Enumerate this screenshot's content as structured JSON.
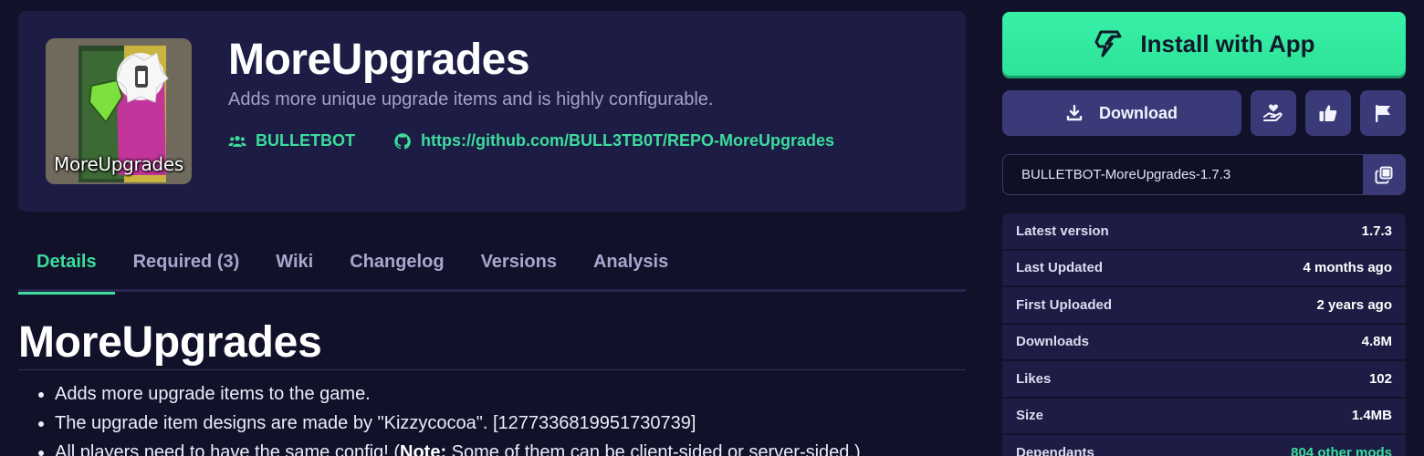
{
  "package": {
    "title": "MoreUpgrades",
    "description": "Adds more unique upgrade items and is highly configurable.",
    "thumbnail_label": "MoreUpgrades",
    "author": "BULLETBOT",
    "repo_url": "https://github.com/BULL3TB0T/REPO-MoreUpgrades"
  },
  "tabs": [
    {
      "label": "Details",
      "active": true
    },
    {
      "label": "Required (3)",
      "active": false
    },
    {
      "label": "Wiki",
      "active": false
    },
    {
      "label": "Changelog",
      "active": false
    },
    {
      "label": "Versions",
      "active": false
    },
    {
      "label": "Analysis",
      "active": false
    }
  ],
  "readme": {
    "title": "MoreUpgrades",
    "items": [
      {
        "text": "Adds more upgrade items to the game."
      },
      {
        "text": "The upgrade item designs are made by \"Kizzycocoa\". [1277336819951730739]"
      },
      {
        "pre": "All players need to have the same config! (",
        "bold": "Note:",
        "post": " Some of them can be client-sided or server-sided.)"
      }
    ]
  },
  "sidebar": {
    "install_label": "Install with App",
    "download_label": "Download",
    "dependency_string": "BULLETBOT-MoreUpgrades-1.7.3",
    "info": [
      {
        "key": "Latest version",
        "value": "1.7.3"
      },
      {
        "key": "Last Updated",
        "value": "4 months ago"
      },
      {
        "key": "First Uploaded",
        "value": "2 years ago"
      },
      {
        "key": "Downloads",
        "value": "4.8M"
      },
      {
        "key": "Likes",
        "value": "102"
      },
      {
        "key": "Size",
        "value": "1.4MB"
      },
      {
        "key": "Dependants",
        "value": "804 other mods"
      }
    ]
  },
  "colors": {
    "background": "#11112a",
    "card": "#1c1c44",
    "accent": "#3cdc9c",
    "button": "#3a3a78"
  },
  "icons": {
    "install": "thunderstore-bolt-icon",
    "download": "download-icon",
    "donate": "hand-heart-icon",
    "like": "thumbs-up-icon",
    "report": "flag-icon",
    "copy": "copy-icon",
    "author": "users-icon",
    "repo": "github-icon"
  }
}
